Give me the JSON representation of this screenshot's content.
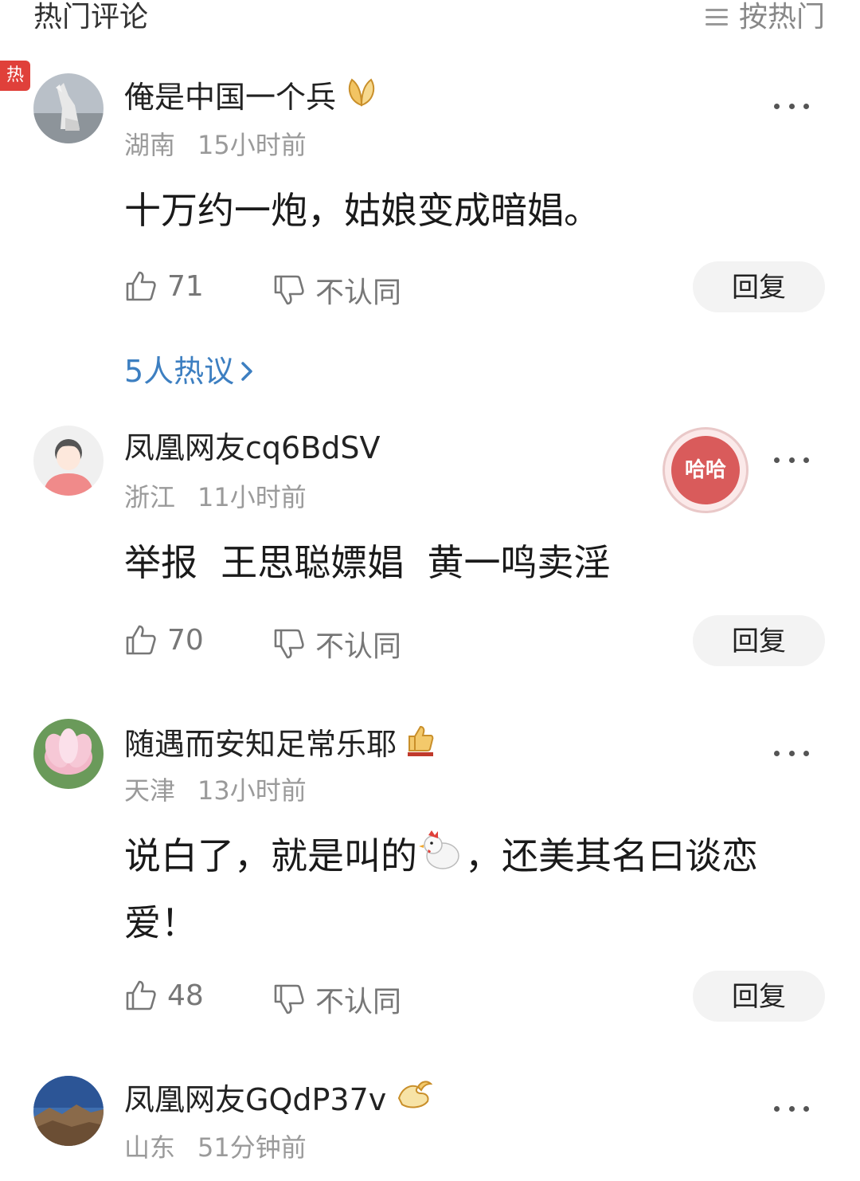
{
  "header": {
    "title": "热门评论",
    "sort_label": "按热门"
  },
  "hot_tag": "热",
  "comments": [
    {
      "username": "俺是中国一个兵",
      "location": "湖南",
      "time": "15小时前",
      "content": "十万约一炮，姑娘变成暗娼。",
      "likes": "71",
      "dislike_label": "不认同",
      "reply_label": "回复"
    },
    {
      "username": "凤凰网友cq6BdSV",
      "location": "浙江",
      "time": "11小时前",
      "content": "举报  王思聪嫖娼  黄一鸣卖淫",
      "likes": "70",
      "dislike_label": "不认同",
      "reply_label": "回复",
      "badge": "哈哈"
    },
    {
      "username": "随遇而安知足常乐耶",
      "location": "天津",
      "time": "13小时前",
      "content_before": "说白了，就是叫的",
      "content_after": "，还美其名曰谈恋爱！",
      "likes": "48",
      "dislike_label": "不认同",
      "reply_label": "回复"
    },
    {
      "username": "凤凰网友GQdP37v",
      "location": "山东",
      "time": "51分钟前"
    }
  ],
  "hot_discuss": "5人热议",
  "colors": {
    "accent_blue": "#3d7fc1",
    "hot_red": "#e0403a",
    "badge_red": "#d95b5b"
  }
}
